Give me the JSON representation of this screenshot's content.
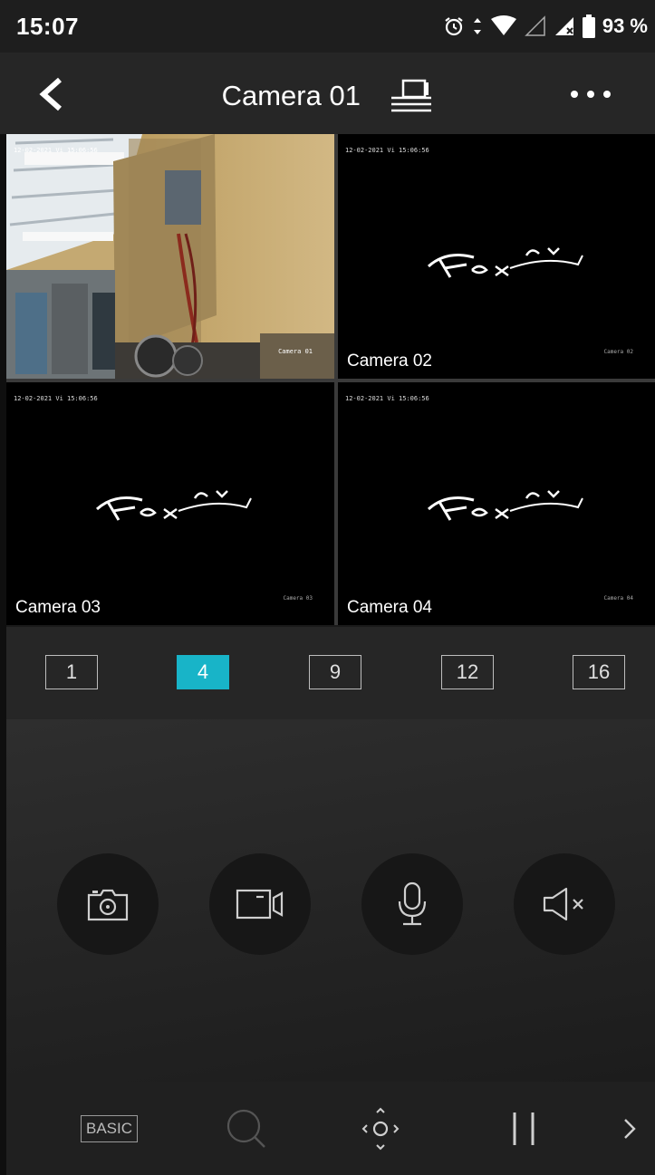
{
  "status": {
    "time": "15:07",
    "battery": "93 %"
  },
  "header": {
    "title": "Camera 01",
    "icons": [
      "back-chevron-icon",
      "multi-screen-icon",
      "more-dots-icon"
    ]
  },
  "cameras": [
    {
      "name": "",
      "timestamp": "12-02-2021 Vi 15:06:56",
      "osd": "Camera 01",
      "live": true
    },
    {
      "name": "Camera 02",
      "timestamp": "12-02-2021 Vi 15:06:56",
      "osd": "Camera 02",
      "live": false
    },
    {
      "name": "Camera 03",
      "timestamp": "12-02-2021 Vi 15:06:56",
      "osd": "Camera 03",
      "live": false
    },
    {
      "name": "Camera 04",
      "timestamp": "12-02-2021 Vi 15:06:56",
      "osd": "Camera 04",
      "live": false
    }
  ],
  "layouts": [
    "1",
    "4",
    "9",
    "12",
    "16"
  ],
  "selected_layout": "4",
  "controls": [
    "snapshot-camera-icon",
    "record-video-icon",
    "microphone-icon",
    "speaker-mute-icon"
  ],
  "toolbar": {
    "basic_label": "BASIC",
    "icons": [
      "zoom-search-icon",
      "ptz-direction-icon",
      "pause-icon",
      "chevron-right-icon"
    ]
  },
  "colors": {
    "accent": "#18b4c8",
    "background": "#1a1a1a"
  }
}
